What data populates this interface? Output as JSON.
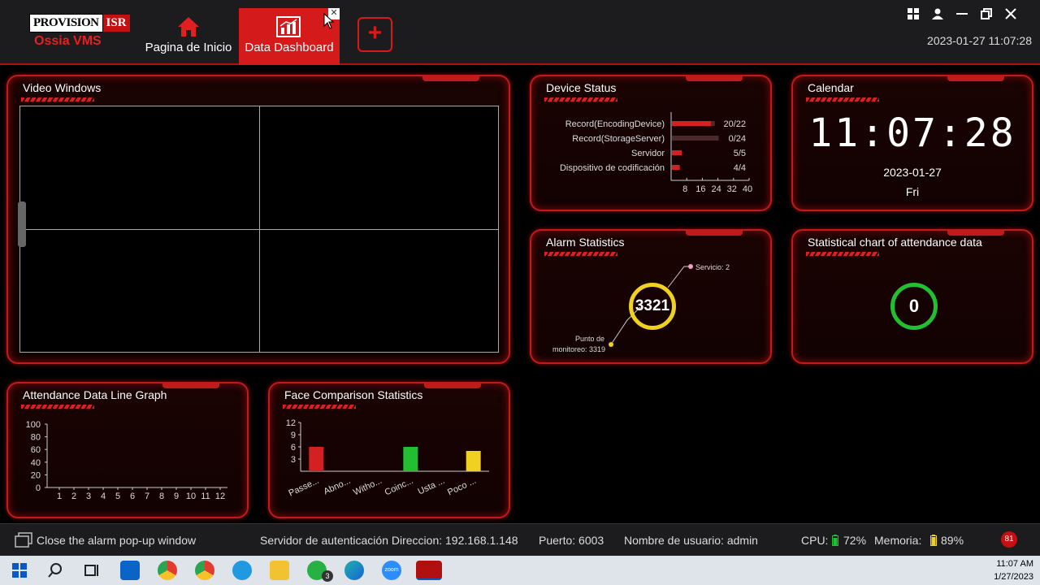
{
  "app": {
    "logo_main": "PROVISION",
    "logo_isr": "ISR",
    "logo_sub": "Ossia VMS",
    "tabs": [
      {
        "label": "Pagina de Inicio"
      },
      {
        "label": "Data Dashboard"
      }
    ],
    "tab_close_glyph": "✕",
    "add_tab_glyph": "+",
    "datetime": "2023-01-27 11:07:28"
  },
  "panels": {
    "video_windows": {
      "title": "Video Windows"
    },
    "device_status": {
      "title": "Device Status",
      "rows": [
        {
          "label": "Record(EncodingDevice)",
          "value": "20/22"
        },
        {
          "label": "Record(StorageServer)",
          "value": "0/24"
        },
        {
          "label": "Servidor",
          "value": "5/5"
        },
        {
          "label": "Dispositivo de codificación",
          "value": "4/4"
        }
      ],
      "ticks": [
        "8",
        "16",
        "24",
        "32",
        "40"
      ]
    },
    "calendar": {
      "title": "Calendar",
      "time": "11:07:28",
      "date": "2023-01-27",
      "day": "Fri"
    },
    "alarm_statistics": {
      "title": "Alarm Statistics",
      "total": "3321",
      "label_top": "Servicio: 2",
      "label_bottom_1": "Punto de",
      "label_bottom_2": "monitoreo: 3319"
    },
    "attendance_stats": {
      "title": "Statistical chart of attendance data",
      "value": "0"
    },
    "attendance_line": {
      "title": "Attendance Data Line Graph"
    },
    "face_comparison": {
      "title": "Face Comparison Statistics"
    }
  },
  "chart_data": [
    {
      "type": "bar",
      "title": "Device Status",
      "categories": [
        "Record(EncodingDevice)",
        "Record(StorageServer)",
        "Servidor",
        "Dispositivo de codificación"
      ],
      "values": [
        20,
        0,
        5,
        4
      ],
      "totals": [
        22,
        24,
        5,
        4
      ],
      "xlim": [
        0,
        40
      ],
      "xticks": [
        8,
        16,
        24,
        32,
        40
      ]
    },
    {
      "type": "line",
      "title": "Attendance Data Line Graph",
      "x": [
        1,
        2,
        3,
        4,
        5,
        6,
        7,
        8,
        9,
        10,
        11,
        12
      ],
      "y": [],
      "ylim": [
        0,
        100
      ],
      "yticks": [
        0,
        20,
        40,
        60,
        80,
        100
      ]
    },
    {
      "type": "bar",
      "title": "Face Comparison Statistics",
      "categories": [
        "Passe...",
        "Abno...",
        "Witho...",
        "Coinc...",
        "Usta ...",
        "Poco ..."
      ],
      "values": [
        6,
        0,
        0,
        6,
        0,
        5
      ],
      "colors": [
        "#d42020",
        "#d42020",
        "#d42020",
        "#22c030",
        "#d42020",
        "#f0d020"
      ],
      "ylim": [
        0,
        12
      ],
      "yticks": [
        3,
        6,
        9,
        12
      ]
    }
  ],
  "statusbar": {
    "close_alarm": "Close the alarm pop-up window",
    "server": "Servidor de autenticación Direccion: 192.168.1.148",
    "port": "Puerto: 6003",
    "user": "Nombre de usuario: admin",
    "cpu_label": "CPU:",
    "cpu_value": "72%",
    "mem_label": "Memoria:",
    "mem_value": "89%",
    "badge": "81"
  },
  "taskbar": {
    "time": "11:07 AM",
    "date": "1/27/2023",
    "whatsapp_badge": "3",
    "zoom_label": "zoom"
  },
  "colors": {
    "accent": "#d41a1a",
    "yellow": "#f0d020",
    "green": "#22c030"
  }
}
